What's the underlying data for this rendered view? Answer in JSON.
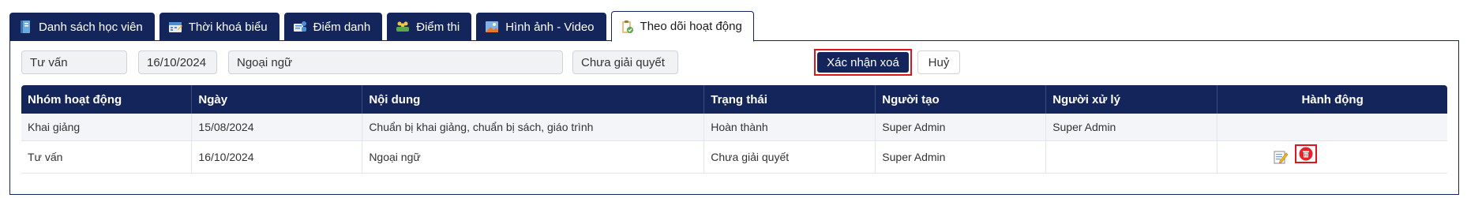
{
  "tabs": [
    {
      "label": "Danh sách học viên",
      "icon": "book-icon",
      "active": false
    },
    {
      "label": "Thời khoá biểu",
      "icon": "schedule-icon",
      "active": false
    },
    {
      "label": "Điểm danh",
      "icon": "attendance-icon",
      "active": false
    },
    {
      "label": "Điểm thi",
      "icon": "students-icon",
      "active": false
    },
    {
      "label": "Hình ảnh - Video",
      "icon": "image-icon",
      "active": false
    },
    {
      "label": "Theo dõi hoạt động",
      "icon": "clipboard-icon",
      "active": true
    }
  ],
  "form": {
    "group": "Tư vấn",
    "date": "16/10/2024",
    "content": "Ngoại ngữ",
    "status": "Chưa giải quyết",
    "confirm_label": "Xác nhận xoá",
    "cancel_label": "Huỷ"
  },
  "table": {
    "headers": [
      "Nhóm hoạt động",
      "Ngày",
      "Nội dung",
      "Trạng thái",
      "Người tạo",
      "Người xử lý",
      "Hành động"
    ],
    "rows": [
      [
        "Khai giảng",
        "15/08/2024",
        "Chuẩn bị khai giảng, chuẩn bị sách, giáo trình",
        "Hoàn thành",
        "Super Admin",
        "Super Admin",
        ""
      ],
      [
        "Tư vấn",
        "16/10/2024",
        "Ngoại ngữ",
        "Chưa giải quyết",
        "Super Admin",
        "",
        ""
      ]
    ]
  },
  "colors": {
    "navy": "#14255c",
    "highlight_red": "#e0141d",
    "delete_red": "#e8222a"
  }
}
